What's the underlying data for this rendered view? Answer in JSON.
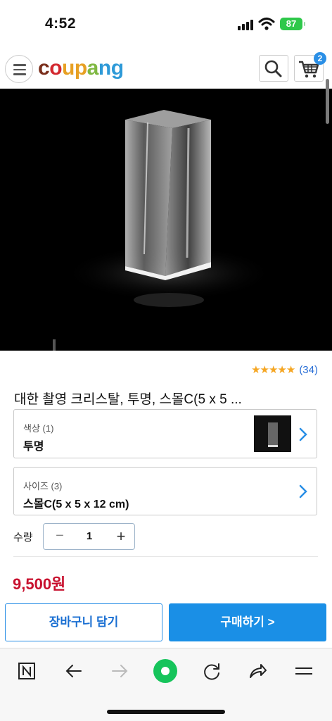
{
  "status_bar": {
    "time": "4:52",
    "battery": "87"
  },
  "header": {
    "logo_letters": [
      {
        "ch": "c",
        "color": "#7a2f1c"
      },
      {
        "ch": "o",
        "color": "#d3282f"
      },
      {
        "ch": "u",
        "color": "#e7a023"
      },
      {
        "ch": "p",
        "color": "#e7a023"
      },
      {
        "ch": "a",
        "color": "#7fb842"
      },
      {
        "ch": "n",
        "color": "#2e9ad8"
      },
      {
        "ch": "g",
        "color": "#2e9ad8"
      }
    ],
    "cart_count": "2",
    "icons": [
      "menu-icon",
      "search-icon",
      "cart-icon"
    ]
  },
  "product": {
    "rating_count": "(34)",
    "stars": "★★★★★",
    "title": "대한 촬영 크리스탈, 투명, 스몰C(5 x 5 ...",
    "color_option": {
      "label": "색상 (1)",
      "value": "투명"
    },
    "size_option": {
      "label": "사이즈 (3)",
      "value": "스몰C(5 x 5 x 12 cm)"
    },
    "quantity": {
      "label": "수량",
      "value": "1",
      "minus": "−",
      "plus": "+"
    },
    "price": "9,500원"
  },
  "actions": {
    "add_to_cart": "장바구니 담기",
    "buy_now": "구매하기 >"
  },
  "colors": {
    "accent": "#1a8fe6",
    "price": "#c8102e",
    "star": "#f5a623"
  },
  "toolbar_icons": [
    "naver-n-icon",
    "back-arrow-icon",
    "forward-arrow-icon",
    "green-dot-icon",
    "reload-icon",
    "share-icon",
    "menu-lines-icon"
  ]
}
